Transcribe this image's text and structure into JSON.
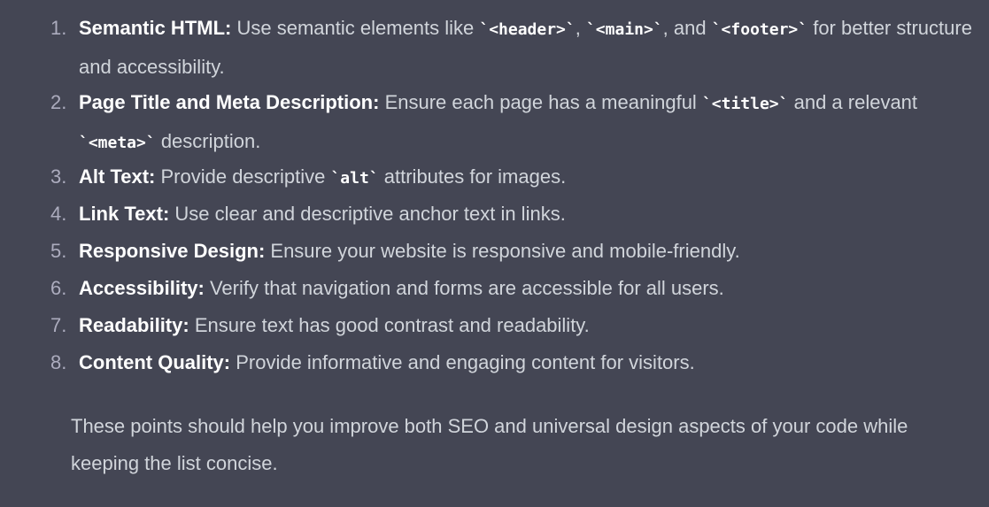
{
  "items": [
    {
      "number": "1.",
      "title": "Semantic HTML:",
      "parts": [
        {
          "t": "text",
          "v": " Use semantic elements like "
        },
        {
          "t": "code",
          "v": "`<header>`"
        },
        {
          "t": "text",
          "v": ", "
        },
        {
          "t": "code",
          "v": "`<main>`"
        },
        {
          "t": "text",
          "v": ", and "
        },
        {
          "t": "code",
          "v": "`<footer>`"
        },
        {
          "t": "text",
          "v": " for better structure and accessibility."
        }
      ]
    },
    {
      "number": "2.",
      "title": "Page Title and Meta Description:",
      "parts": [
        {
          "t": "text",
          "v": " Ensure each page has a meaningful "
        },
        {
          "t": "code",
          "v": "`<title>`"
        },
        {
          "t": "text",
          "v": " and a relevant "
        },
        {
          "t": "code",
          "v": "`<meta>`"
        },
        {
          "t": "text",
          "v": " description."
        }
      ]
    },
    {
      "number": "3.",
      "title": "Alt Text:",
      "parts": [
        {
          "t": "text",
          "v": " Provide descriptive "
        },
        {
          "t": "code",
          "v": "`alt`"
        },
        {
          "t": "text",
          "v": " attributes for images."
        }
      ]
    },
    {
      "number": "4.",
      "title": "Link Text:",
      "parts": [
        {
          "t": "text",
          "v": " Use clear and descriptive anchor text in links."
        }
      ]
    },
    {
      "number": "5.",
      "title": "Responsive Design:",
      "parts": [
        {
          "t": "text",
          "v": " Ensure your website is responsive and mobile-friendly."
        }
      ]
    },
    {
      "number": "6.",
      "title": "Accessibility:",
      "parts": [
        {
          "t": "text",
          "v": " Verify that navigation and forms are accessible for all users."
        }
      ]
    },
    {
      "number": "7.",
      "title": "Readability:",
      "parts": [
        {
          "t": "text",
          "v": " Ensure text has good contrast and readability."
        }
      ]
    },
    {
      "number": "8.",
      "title": "Content Quality:",
      "parts": [
        {
          "t": "text",
          "v": " Provide informative and engaging content for visitors."
        }
      ]
    }
  ],
  "summary": "These points should help you improve both SEO and universal design aspects of your code while keeping the list concise.",
  "colors": {
    "background": "#444654",
    "text": "#d1d5db",
    "bold": "#ffffff",
    "number": "#acacbe"
  }
}
